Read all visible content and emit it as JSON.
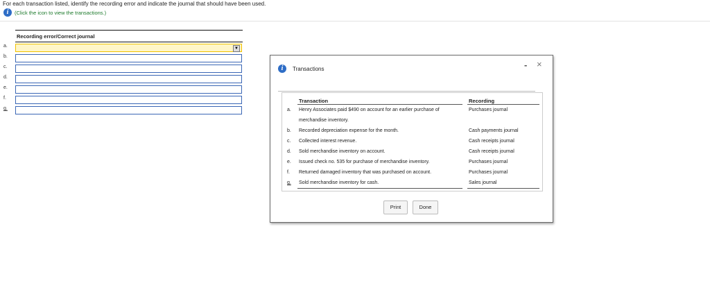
{
  "instructions": "For each transaction listed, identify the recording error and indicate the journal that should have been used.",
  "hint_text": "(Click the icon to view the transactions.)",
  "answer_table": {
    "header": "Recording error/Correct journal",
    "rows": [
      {
        "label": "a.",
        "value": ""
      },
      {
        "label": "b.",
        "value": ""
      },
      {
        "label": "c.",
        "value": ""
      },
      {
        "label": "d.",
        "value": ""
      },
      {
        "label": "e.",
        "value": ""
      },
      {
        "label": "f.",
        "value": ""
      },
      {
        "label": "g.",
        "value": ""
      }
    ]
  },
  "modal": {
    "title": "Transactions",
    "minimize": "-",
    "close": "×",
    "columns": {
      "transaction": "Transaction",
      "recording": "Recording"
    },
    "rows": [
      {
        "label": "a.",
        "transaction": "Henry Associates paid $490 on account for an earlier purchase of merchandise inventory.",
        "recording": "Purchases journal"
      },
      {
        "label": "b.",
        "transaction": "Recorded depreciation expense for the month.",
        "recording": "Cash payments journal"
      },
      {
        "label": "c.",
        "transaction": "Collected interest revenue.",
        "recording": "Cash receipts journal"
      },
      {
        "label": "d.",
        "transaction": "Sold merchandise inventory on account.",
        "recording": "Cash receipts journal"
      },
      {
        "label": "e.",
        "transaction": "Issued check no. 535 for purchase of merchandise inventory.",
        "recording": "Purchases journal"
      },
      {
        "label": "f.",
        "transaction": "Returned damaged inventory that was purchased on account.",
        "recording": "Purchases journal"
      },
      {
        "label": "g.",
        "transaction": "Sold merchandise inventory for cash.",
        "recording": "Sales journal"
      }
    ],
    "buttons": {
      "print": "Print",
      "done": "Done"
    }
  },
  "icons": {
    "info": "info-icon",
    "dropdown": "dropdown-arrow-icon",
    "close": "close-icon",
    "minimize": "minimize-icon"
  }
}
